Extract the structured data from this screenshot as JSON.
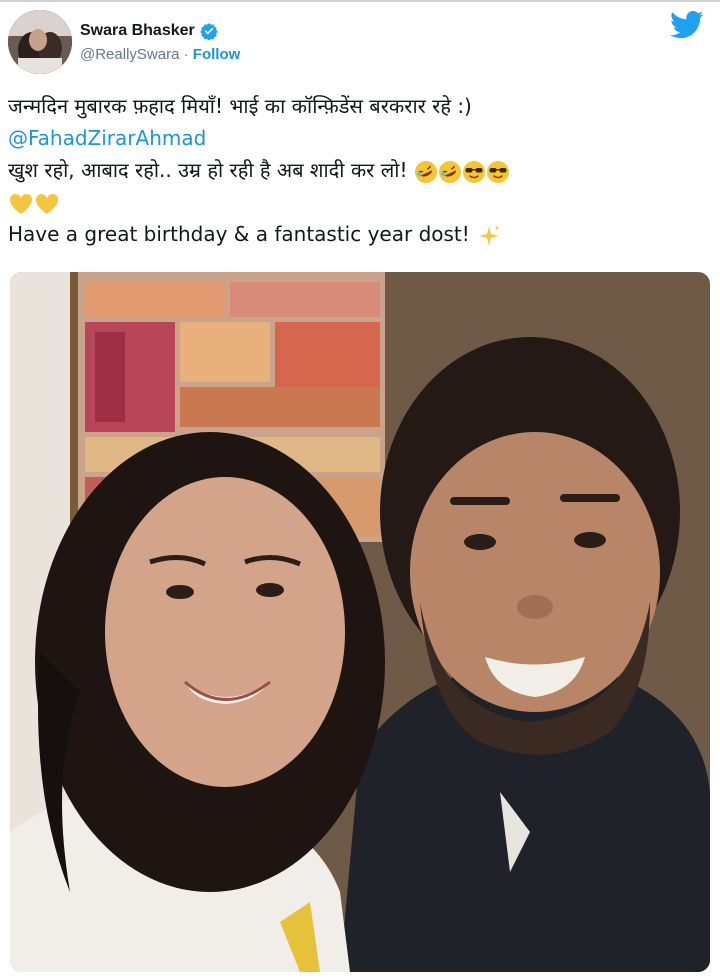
{
  "tweet": {
    "author_name": "Swara Bhasker",
    "handle": "@ReallySwara",
    "separator": " · ",
    "follow_label": "Follow",
    "text_line1": "जन्मदिन मुबारक फ़हाद मियाँ! भाई का कॉन्फ़िडेंस बरकरार रहे :)",
    "mention": "@FahadZirarAhmad",
    "text_line3": "खुश रहो, आबाद रहो.. उम्र हो रही है अब शादी कर लो!",
    "text_line5": "Have a great birthday & a fantastic year dost!",
    "emojis_line3": [
      "rolling-laughing-emoji",
      "rolling-laughing-emoji",
      "sunglasses-emoji",
      "sunglasses-emoji"
    ],
    "emojis_line4": [
      "yellow-heart-emoji",
      "yellow-heart-emoji"
    ],
    "emojis_line5": [
      "sparkles-emoji"
    ]
  },
  "colors": {
    "link": "#1b95e0",
    "twitter_blue": "#1da1f2",
    "text": "#14171a",
    "muted": "#657786"
  },
  "icons": {
    "verified": "verified-badge-icon",
    "brand": "twitter-bird-icon"
  }
}
